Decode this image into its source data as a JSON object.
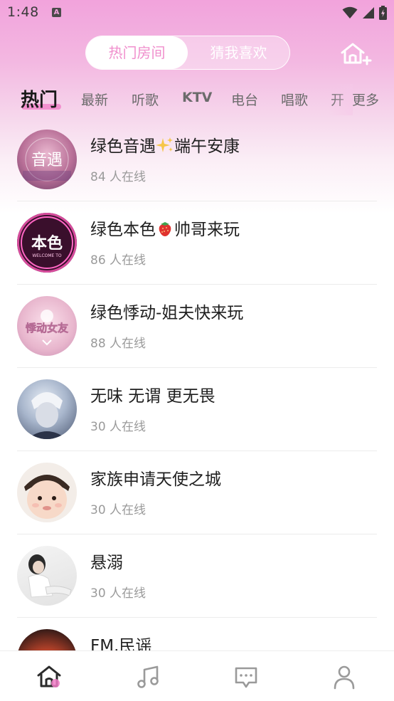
{
  "status_bar": {
    "time": "1:48",
    "app_icon_letter": "A"
  },
  "top_tabs": [
    {
      "label": "热门房间",
      "active": true
    },
    {
      "label": "猜我喜欢",
      "active": false
    }
  ],
  "categories": [
    {
      "label": "热门",
      "active": true
    },
    {
      "label": "最新"
    },
    {
      "label": "听歌"
    },
    {
      "label": "KTV"
    },
    {
      "label": "电台"
    },
    {
      "label": "唱歌"
    },
    {
      "label": "开"
    }
  ],
  "more_label": "更多",
  "rooms": [
    {
      "name_a": "绿色音遇",
      "emoji": "sparkles-icon",
      "name_b": "端午安康",
      "online": "84 人在线"
    },
    {
      "name_a": "绿色本色",
      "emoji": "strawberry-icon",
      "name_b": "帅哥来玩",
      "online": "86 人在线"
    },
    {
      "name_a": "绿色悸动-姐夫快来玩",
      "online": "88 人在线"
    },
    {
      "name_a": "无味 无谓 更无畏",
      "online": "30 人在线"
    },
    {
      "name_a": "家族申请天使之城",
      "online": "30 人在线"
    },
    {
      "name_a": "悬溺",
      "online": "30 人在线"
    },
    {
      "name_a": "FM.民谣",
      "online": ""
    }
  ],
  "avatar_texts": {
    "room1": "音遇",
    "room2": "本色",
    "room2_sub": "WELCOME TO",
    "room3": "悸动女友"
  },
  "bottom_nav": [
    {
      "icon": "home-icon",
      "active": true
    },
    {
      "icon": "music-note-icon"
    },
    {
      "icon": "message-icon"
    },
    {
      "icon": "profile-icon"
    }
  ],
  "colors": {
    "accent": "#f07bc6",
    "header_gradient_top": "#f2a3dc"
  }
}
